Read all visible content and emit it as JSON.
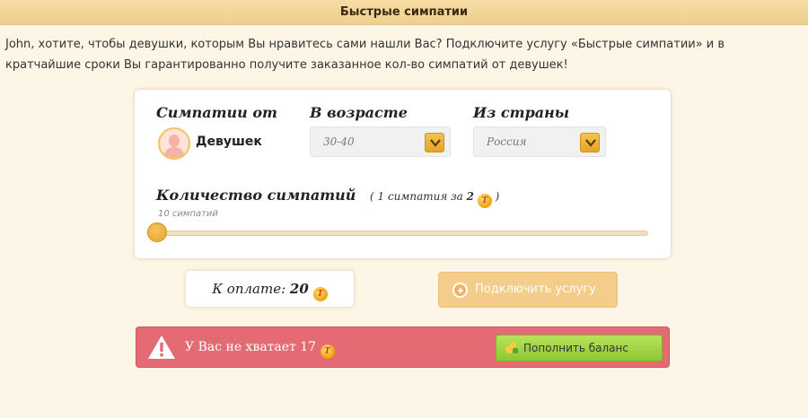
{
  "header": {
    "title": "Быстрые симпатии"
  },
  "intro": {
    "text": "John, хотите, чтобы девушки, которым Вы нравитесь сами нашли Вас? Подключите услугу «Быстрые симпатии» и в кратчайшие сроки Вы гарантированно получите заказанное кол-во симпатий от девушек!"
  },
  "form": {
    "from_label": "Симпатии от",
    "from_value": "Девушек",
    "age_label": "В возрасте",
    "age_value": "30-40",
    "country_label": "Из страны",
    "country_value": "Россия",
    "count_label": "Количество симпатий",
    "count_note_prefix": "( 1 симпатия за ",
    "count_note_price": "2",
    "count_note_suffix": " )",
    "slider_value_text": "10 симпатий",
    "slider_fraction": 0
  },
  "payment": {
    "label": "К оплате:",
    "amount": "20",
    "connect_label": "Подключить услугу"
  },
  "alert": {
    "message": "У Вас не хватает 17",
    "topup_label": "Пополнить баланс"
  },
  "currency": {
    "glyph": "T"
  },
  "colors": {
    "accent": "#e5a434",
    "alert": "#e46b74",
    "topup": "#9ccf3e"
  }
}
